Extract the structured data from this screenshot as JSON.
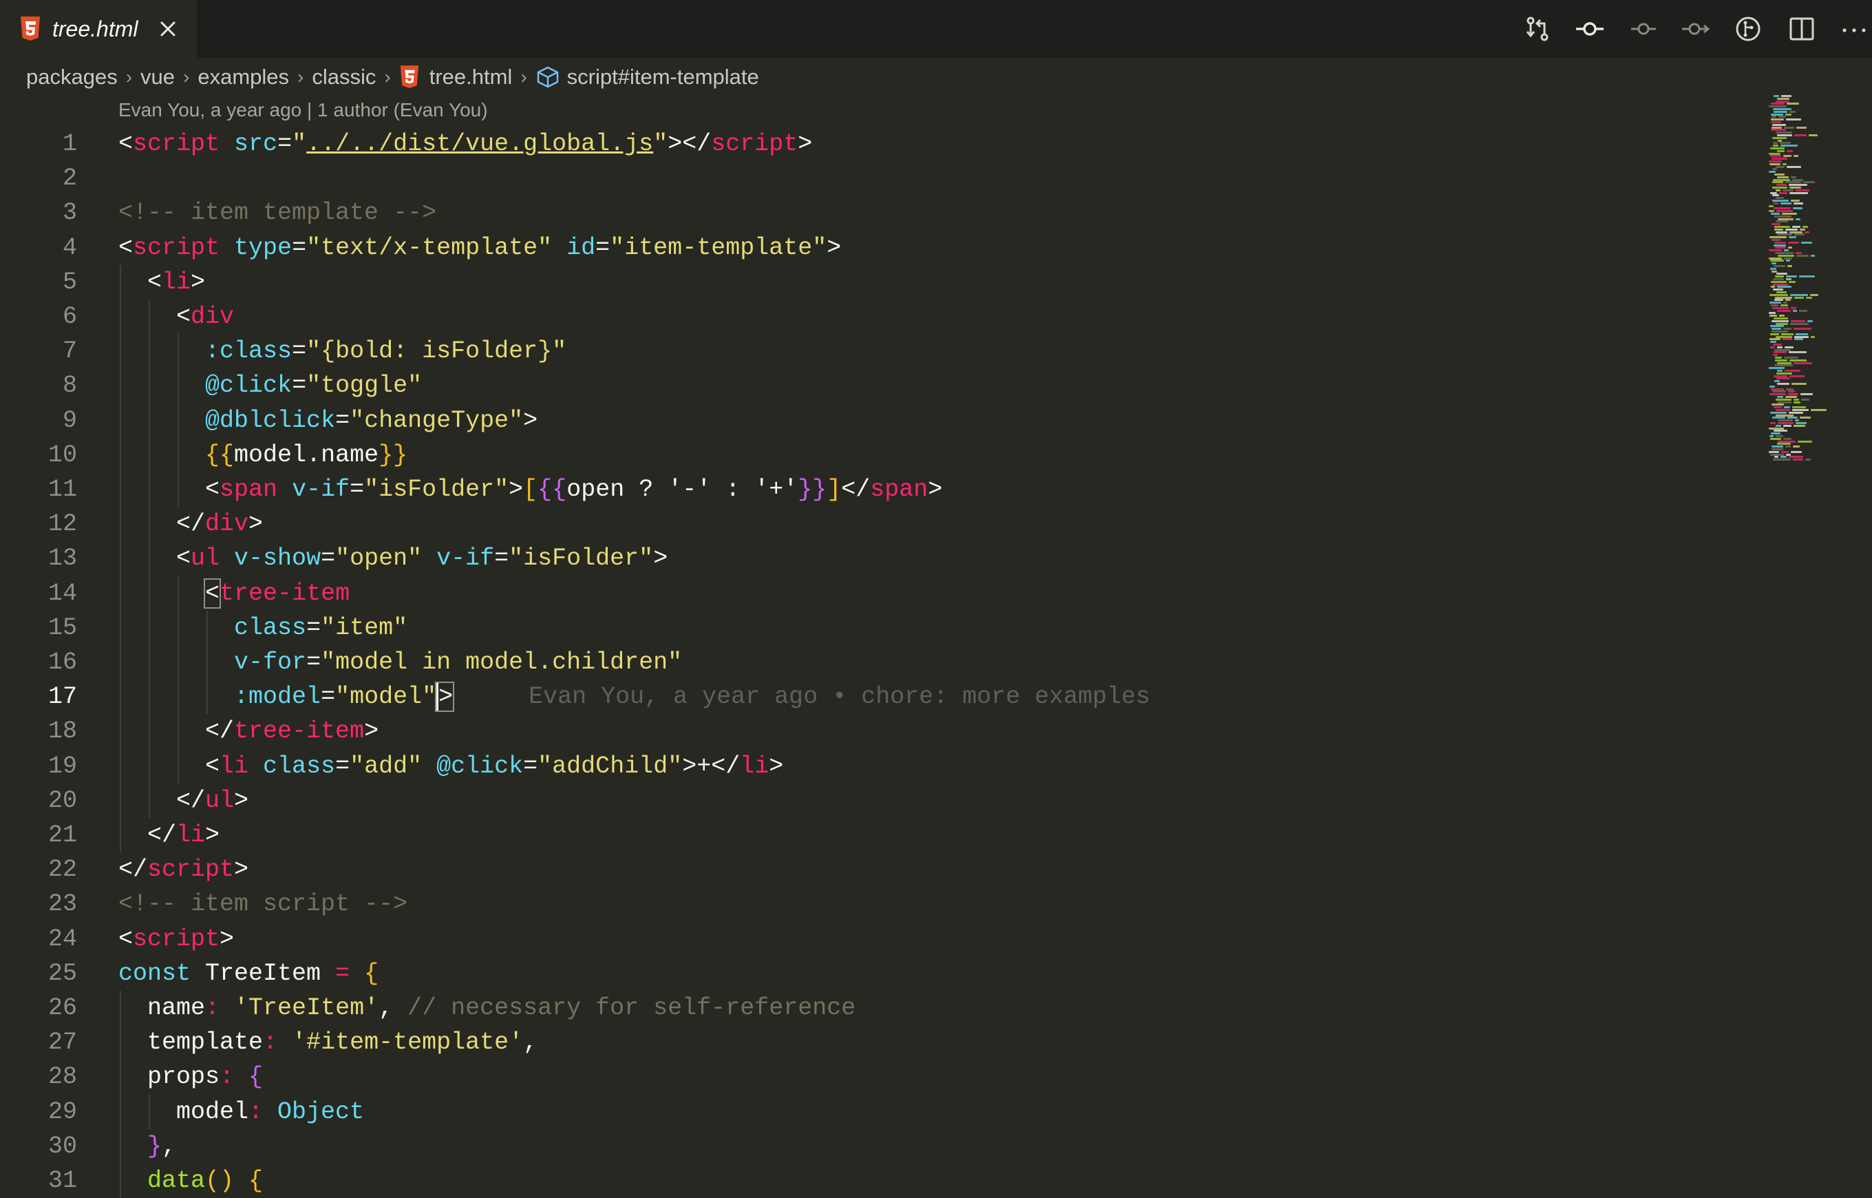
{
  "tab": {
    "title": "tree.html",
    "file_icon": "html5-icon",
    "close_icon": "close-icon"
  },
  "actions": [
    {
      "name": "open-changes-icon"
    },
    {
      "name": "git-commit-icon"
    },
    {
      "name": "previous-change-icon"
    },
    {
      "name": "next-change-icon"
    },
    {
      "name": "git-blame-icon"
    },
    {
      "name": "split-editor-icon"
    },
    {
      "name": "more-actions-icon"
    }
  ],
  "breadcrumb": {
    "items": [
      "packages",
      "vue",
      "examples",
      "classic",
      "tree.html",
      "script#item-template"
    ]
  },
  "codelens": "Evan You, a year ago | 1 author (Evan You)",
  "blame": "Evan You, a year ago • chore: more examples",
  "editor": {
    "active_line": 17,
    "line_numbers": [
      "1",
      "2",
      "3",
      "4",
      "5",
      "6",
      "7",
      "8",
      "9",
      "10",
      "11",
      "12",
      "13",
      "14",
      "15",
      "16",
      "17",
      "18",
      "19",
      "20",
      "21",
      "22",
      "23",
      "24",
      "25",
      "26",
      "27",
      "28",
      "29",
      "30",
      "31"
    ],
    "lines": [
      [
        [
          "t",
          "<"
        ],
        [
          "k",
          "script "
        ],
        [
          "a",
          "src"
        ],
        [
          "t",
          "="
        ],
        [
          "s",
          "\""
        ],
        [
          "s u",
          "../../dist/vue.global.js"
        ],
        [
          "s",
          "\""
        ],
        [
          "t",
          "></"
        ],
        [
          "k",
          "script"
        ],
        [
          "t",
          ">"
        ]
      ],
      [],
      [
        [
          "c",
          "<!-- item template -->"
        ]
      ],
      [
        [
          "t",
          "<"
        ],
        [
          "k",
          "script "
        ],
        [
          "a",
          "type"
        ],
        [
          "t",
          "="
        ],
        [
          "s",
          "\"text/x-template\" "
        ],
        [
          "a",
          "id"
        ],
        [
          "t",
          "="
        ],
        [
          "s",
          "\"item-template\""
        ],
        [
          "t",
          ">"
        ]
      ],
      [
        [
          "t",
          "  <"
        ],
        [
          "k",
          "li"
        ],
        [
          "t",
          ">"
        ]
      ],
      [
        [
          "t",
          "    <"
        ],
        [
          "k",
          "div"
        ]
      ],
      [
        [
          "t",
          "      "
        ],
        [
          "a",
          ":class"
        ],
        [
          "t",
          "="
        ],
        [
          "s",
          "\"{bold: isFolder}\""
        ]
      ],
      [
        [
          "t",
          "      "
        ],
        [
          "a",
          "@click"
        ],
        [
          "t",
          "="
        ],
        [
          "s",
          "\"toggle\""
        ]
      ],
      [
        [
          "t",
          "      "
        ],
        [
          "a",
          "@dblclick"
        ],
        [
          "t",
          "="
        ],
        [
          "s",
          "\"changeType\""
        ],
        [
          "t",
          ">"
        ]
      ],
      [
        [
          "t",
          "      "
        ],
        [
          "y",
          "{{"
        ],
        [
          "t",
          "model.name"
        ],
        [
          "y",
          "}}"
        ]
      ],
      [
        [
          "t",
          "      <"
        ],
        [
          "k",
          "span "
        ],
        [
          "a",
          "v-if"
        ],
        [
          "t",
          "="
        ],
        [
          "s",
          "\"isFolder\""
        ],
        [
          "t",
          ">"
        ],
        [
          "y",
          "["
        ],
        [
          "m",
          "{{"
        ],
        [
          "t",
          "open ? '-' : '+'"
        ],
        [
          "m",
          "}}"
        ],
        [
          "y",
          "]"
        ],
        [
          "t",
          "</"
        ],
        [
          "k",
          "span"
        ],
        [
          "t",
          ">"
        ]
      ],
      [
        [
          "t",
          "    </"
        ],
        [
          "k",
          "div"
        ],
        [
          "t",
          ">"
        ]
      ],
      [
        [
          "t",
          "    <"
        ],
        [
          "k",
          "ul "
        ],
        [
          "a",
          "v-show"
        ],
        [
          "t",
          "="
        ],
        [
          "s",
          "\"open\" "
        ],
        [
          "a",
          "v-if"
        ],
        [
          "t",
          "="
        ],
        [
          "s",
          "\"isFolder\""
        ],
        [
          "t",
          ">"
        ]
      ],
      [
        [
          "t",
          "      "
        ],
        [
          "t bracket",
          "<"
        ],
        [
          "k",
          "tree-item"
        ]
      ],
      [
        [
          "t",
          "        "
        ],
        [
          "a",
          "class"
        ],
        [
          "t",
          "="
        ],
        [
          "s",
          "\"item\""
        ]
      ],
      [
        [
          "t",
          "        "
        ],
        [
          "a",
          "v-for"
        ],
        [
          "t",
          "="
        ],
        [
          "s",
          "\"model in model.children\""
        ]
      ],
      [
        [
          "t",
          "        "
        ],
        [
          "a",
          ":model"
        ],
        [
          "t",
          "="
        ],
        [
          "s",
          "\"model\""
        ],
        [
          "t bracket cursor",
          ">"
        ]
      ],
      [
        [
          "t",
          "      </"
        ],
        [
          "k",
          "tree-item"
        ],
        [
          "t",
          ">"
        ]
      ],
      [
        [
          "t",
          "      <"
        ],
        [
          "k",
          "li "
        ],
        [
          "a",
          "class"
        ],
        [
          "t",
          "="
        ],
        [
          "s",
          "\"add\" "
        ],
        [
          "a",
          "@click"
        ],
        [
          "t",
          "="
        ],
        [
          "s",
          "\"addChild\""
        ],
        [
          "t",
          ">+</"
        ],
        [
          "k",
          "li"
        ],
        [
          "t",
          ">"
        ]
      ],
      [
        [
          "t",
          "    </"
        ],
        [
          "k",
          "ul"
        ],
        [
          "t",
          ">"
        ]
      ],
      [
        [
          "t",
          "  </"
        ],
        [
          "k",
          "li"
        ],
        [
          "t",
          ">"
        ]
      ],
      [
        [
          "t",
          "</"
        ],
        [
          "k",
          "script"
        ],
        [
          "t",
          ">"
        ]
      ],
      [
        [
          "c",
          "<!-- item script -->"
        ]
      ],
      [
        [
          "t",
          "<"
        ],
        [
          "k",
          "script"
        ],
        [
          "t",
          ">"
        ]
      ],
      [
        [
          "a",
          "const "
        ],
        [
          "t",
          "TreeItem "
        ],
        [
          "k",
          "= "
        ],
        [
          "y",
          "{"
        ]
      ],
      [
        [
          "t",
          "  name"
        ],
        [
          "k",
          ": "
        ],
        [
          "s",
          "'TreeItem'"
        ],
        [
          "t",
          ", "
        ],
        [
          "c",
          "// necessary for self-reference"
        ]
      ],
      [
        [
          "t",
          "  template"
        ],
        [
          "k",
          ": "
        ],
        [
          "s",
          "'#item-template'"
        ],
        [
          "t",
          ","
        ]
      ],
      [
        [
          "t",
          "  props"
        ],
        [
          "k",
          ": "
        ],
        [
          "m",
          "{"
        ]
      ],
      [
        [
          "t",
          "    model"
        ],
        [
          "k",
          ": "
        ],
        [
          "a",
          "Object"
        ]
      ],
      [
        [
          "m",
          "  }"
        ],
        [
          "t",
          ","
        ]
      ],
      [
        [
          "g",
          "  data"
        ],
        [
          "y",
          "() "
        ],
        [
          "y",
          "{"
        ]
      ]
    ]
  }
}
